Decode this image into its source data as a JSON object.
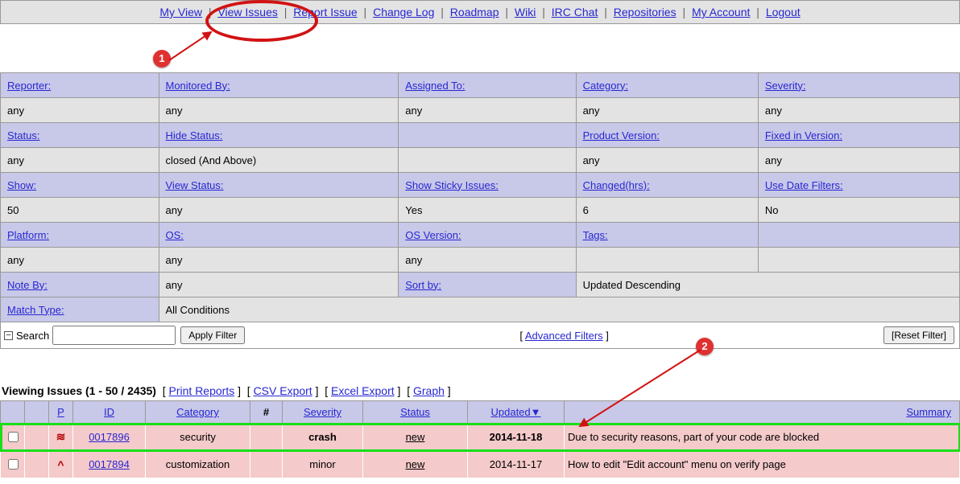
{
  "nav": {
    "my_view": "My View",
    "view_issues": "View Issues",
    "report_issue": "Report Issue",
    "change_log": "Change Log",
    "roadmap": "Roadmap",
    "wiki": "Wiki",
    "irc_chat": "IRC Chat",
    "repositories": "Repositories",
    "my_account": "My Account",
    "logout": "Logout"
  },
  "filters": {
    "r1": {
      "reporter_h": "Reporter:",
      "reporter_v": "any",
      "monitored_h": "Monitored By:",
      "monitored_v": "any",
      "assigned_h": "Assigned To:",
      "assigned_v": "any",
      "category_h": "Category:",
      "category_v": "any",
      "severity_h": "Severity:",
      "severity_v": "any"
    },
    "r2": {
      "status_h": "Status:",
      "status_v": "any",
      "hide_h": "Hide Status:",
      "hide_v": "closed (And Above)",
      "product_h": "Product Version:",
      "product_v": "any",
      "fixed_h": "Fixed in Version:",
      "fixed_v": "any"
    },
    "r3": {
      "show_h": "Show:",
      "show_v": "50",
      "viewstatus_h": "View Status:",
      "viewstatus_v": "any",
      "sticky_h": "Show Sticky Issues:",
      "sticky_v": "Yes",
      "changed_h": "Changed(hrs):",
      "changed_v": "6",
      "datefilters_h": "Use Date Filters:",
      "datefilters_v": "No"
    },
    "r4": {
      "platform_h": "Platform:",
      "platform_v": "any",
      "os_h": "OS:",
      "os_v": "any",
      "osver_h": "OS Version:",
      "osver_v": "any",
      "tags_h": "Tags:"
    },
    "r5": {
      "noteby_h": "Note By:",
      "noteby_v": "any",
      "sortby_h": "Sort by:",
      "sortby_v": "Updated Descending"
    },
    "r6": {
      "match_h": "Match Type:",
      "match_v": "All Conditions"
    }
  },
  "search": {
    "label": "Search",
    "apply": "Apply Filter",
    "advanced": "Advanced Filters",
    "reset": "[Reset Filter]"
  },
  "issues_header": {
    "title": "Viewing Issues (1 - 50 / 2435)",
    "print": "Print Reports",
    "csv": "CSV Export",
    "excel": "Excel Export",
    "graph": "Graph"
  },
  "columns": {
    "p": "P",
    "id": "ID",
    "category": "Category",
    "hash": "#",
    "severity": "Severity",
    "status": "Status",
    "updated": "Updated",
    "summary": "Summary"
  },
  "rows": [
    {
      "priority_icon": "≋",
      "id": "0017896",
      "category": "security",
      "severity": "crash",
      "severity_bold": true,
      "status": "new",
      "updated": "2014-11-18",
      "updated_bold": true,
      "summary": "Due to security reasons, part of your code are blocked",
      "highlight": true
    },
    {
      "priority_icon": "^",
      "id": "0017894",
      "category": "customization",
      "severity": "minor",
      "severity_bold": false,
      "status": "new",
      "updated": "2014-11-17",
      "updated_bold": false,
      "summary": "How to edit \"Edit account\" menu on verify page",
      "highlight": false
    }
  ],
  "annotations": {
    "badge1": "1",
    "badge2": "2"
  }
}
